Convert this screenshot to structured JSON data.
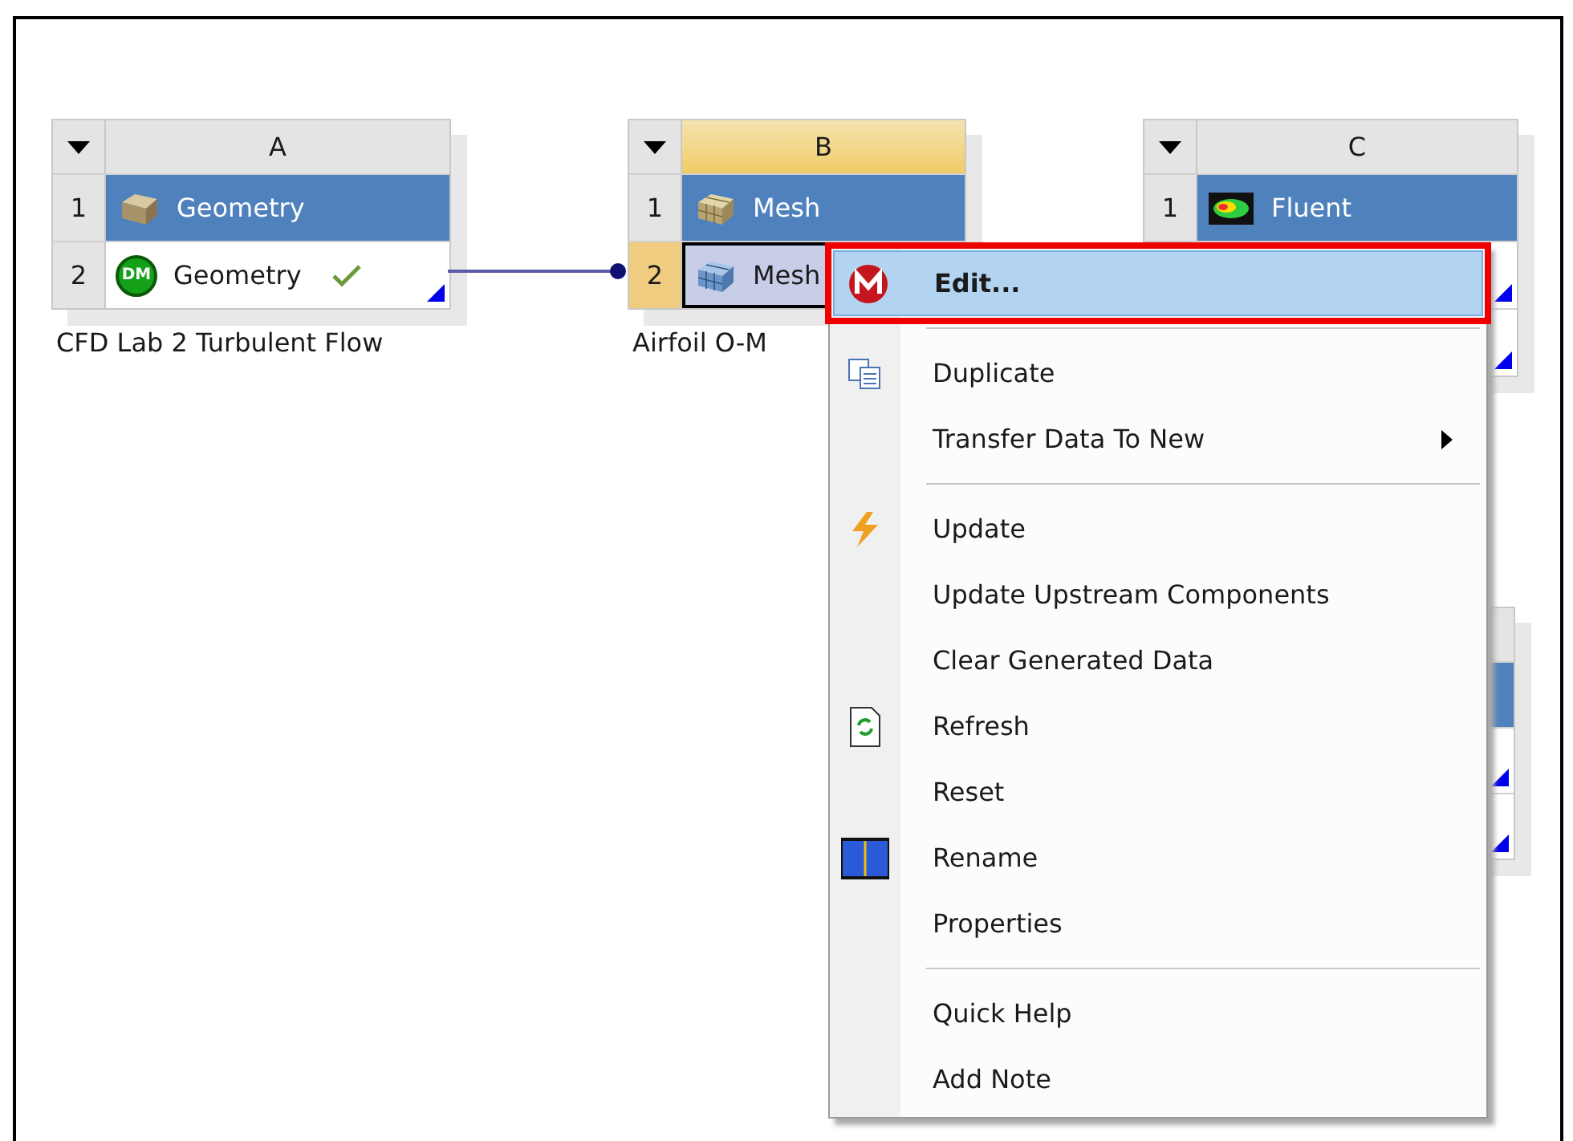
{
  "systems": [
    {
      "column": "A",
      "selected": false,
      "caption": "CFD Lab 2 Turbulent Flow",
      "rows": [
        {
          "kind": "title",
          "number": "1",
          "label": "Geometry",
          "selected": false,
          "up_to_date": false
        },
        {
          "kind": "cell",
          "number": "2",
          "label": "Geometry",
          "badge": "DM",
          "selected": false,
          "up_to_date": true,
          "output_marker": true
        }
      ]
    },
    {
      "column": "B",
      "selected": true,
      "caption": "Airfoil O-M",
      "rows": [
        {
          "kind": "title",
          "number": "1",
          "label": "Mesh",
          "selected": false,
          "up_to_date": false
        },
        {
          "kind": "cell",
          "number": "2",
          "label": "Mesh",
          "selected": true,
          "up_to_date": false
        }
      ]
    },
    {
      "column": "C",
      "selected": false,
      "rows": [
        {
          "kind": "title",
          "number": "1",
          "label": "Fluent",
          "selected": false,
          "up_to_date": false
        },
        {
          "kind": "cell",
          "output_marker": true
        },
        {
          "kind": "cell",
          "output_marker": true
        }
      ]
    }
  ],
  "context_menu": {
    "groups": [
      [
        {
          "label": "Edit...",
          "selected": true,
          "submenu": false
        }
      ],
      [
        {
          "label": "Duplicate",
          "selected": false,
          "submenu": false
        },
        {
          "label": "Transfer Data To New",
          "selected": false,
          "submenu": true
        }
      ],
      [
        {
          "label": "Update",
          "selected": false,
          "submenu": false
        },
        {
          "label": "Update Upstream Components",
          "selected": false,
          "submenu": false
        },
        {
          "label": "Clear Generated Data",
          "selected": false,
          "submenu": false
        },
        {
          "label": "Refresh",
          "selected": false,
          "submenu": false
        },
        {
          "label": "Reset",
          "selected": false,
          "submenu": false
        },
        {
          "label": "Rename",
          "selected": false,
          "submenu": false
        },
        {
          "label": "Properties",
          "selected": false,
          "submenu": false
        }
      ],
      [
        {
          "label": "Quick Help",
          "selected": false,
          "submenu": false
        },
        {
          "label": "Add Note",
          "selected": false,
          "submenu": false
        }
      ]
    ]
  }
}
